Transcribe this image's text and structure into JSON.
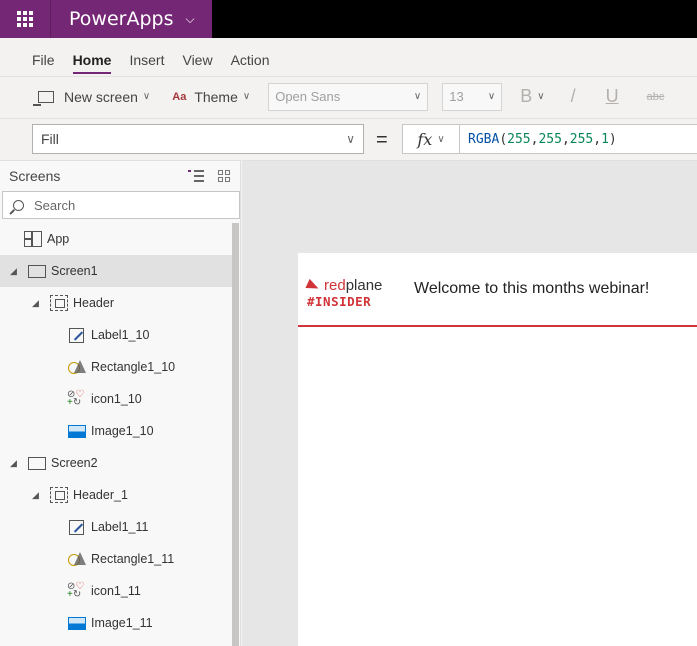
{
  "app": {
    "name": "PowerApps"
  },
  "menu": {
    "items": [
      "File",
      "Home",
      "Insert",
      "View",
      "Action"
    ],
    "active": "Home"
  },
  "toolbar": {
    "new_screen": "New screen",
    "theme": "Theme",
    "theme_icon_text": "Aa",
    "font": "Open Sans",
    "font_size": "13",
    "bold": "B",
    "italic": "/",
    "underline": "U",
    "strike": "abc"
  },
  "formula": {
    "property": "Fill",
    "equals": "=",
    "fx": "fx",
    "text_func": "RGBA",
    "args": [
      "255",
      "255",
      "255",
      "1"
    ]
  },
  "tree": {
    "title": "Screens",
    "search_placeholder": "Search",
    "app_label": "App",
    "screen1": {
      "label": "Screen1",
      "group": "Header",
      "children": [
        "Label1_10",
        "Rectangle1_10",
        "icon1_10",
        "Image1_10"
      ]
    },
    "screen2": {
      "label": "Screen2",
      "group": "Header_1",
      "children": [
        "Label1_11",
        "Rectangle1_11",
        "icon1_11",
        "Image1_11"
      ]
    }
  },
  "canvas": {
    "logo_red": "red",
    "logo_dark": "plane",
    "logo_tag": "#INSIDER",
    "welcome": "Welcome to this months webinar!"
  },
  "colors": {
    "accent": "#742774",
    "brand_red": "#d13438",
    "topbar": "#000000"
  }
}
